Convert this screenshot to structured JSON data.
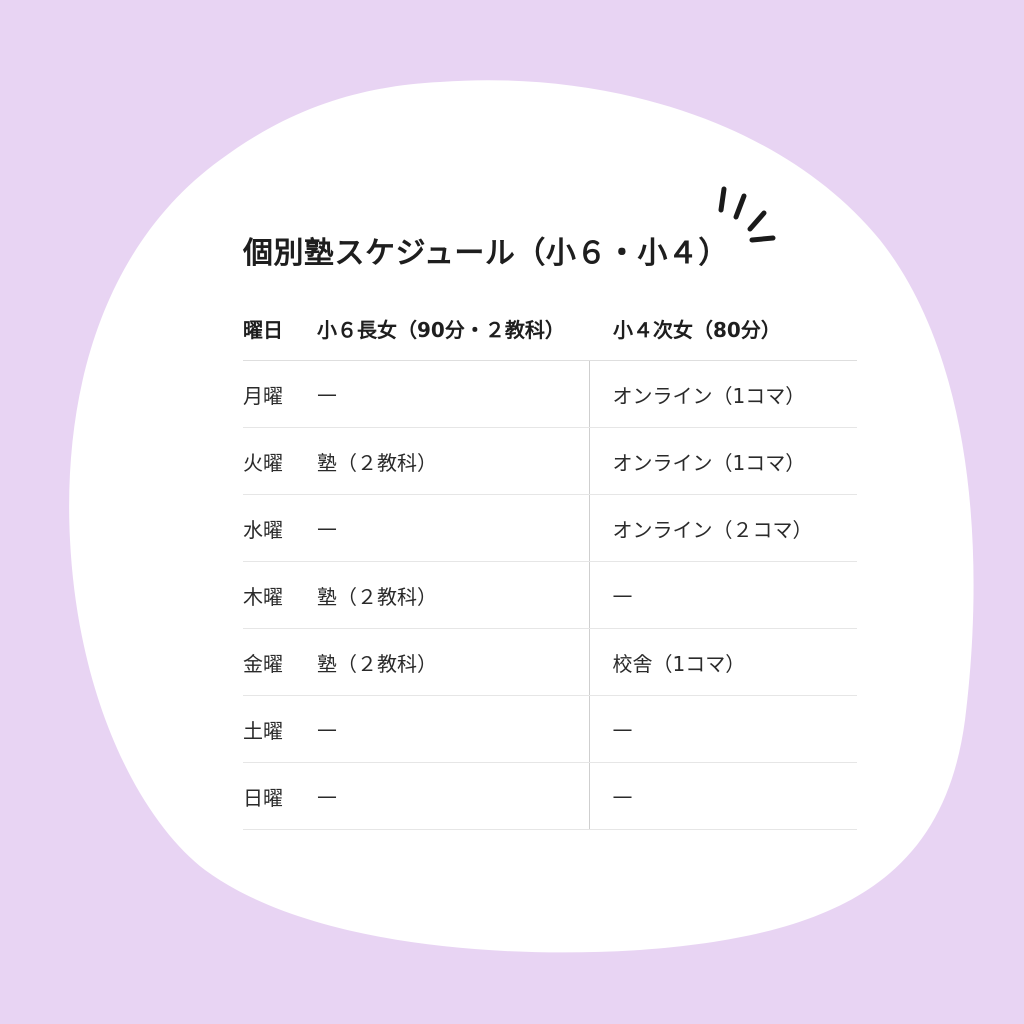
{
  "colors": {
    "background": "#e8d4f3",
    "card": "#ffffff",
    "text": "#222222",
    "divider": "#dedede"
  },
  "title": "個別塾スケジュール（小６・小４）",
  "table": {
    "headers": [
      "曜日",
      "小６長女（90分・２教科）",
      "小４次女（80分）"
    ],
    "rows": [
      {
        "day": "月曜",
        "elder": "—",
        "younger": "オンライン（1コマ）"
      },
      {
        "day": "火曜",
        "elder": "塾（２教科）",
        "younger": "オンライン（1コマ）"
      },
      {
        "day": "水曜",
        "elder": "—",
        "younger": "オンライン（２コマ）"
      },
      {
        "day": "木曜",
        "elder": "塾（２教科）",
        "younger": "—"
      },
      {
        "day": "金曜",
        "elder": "塾（２教科）",
        "younger": "校舎（1コマ）"
      },
      {
        "day": "土曜",
        "elder": "—",
        "younger": "—"
      },
      {
        "day": "日曜",
        "elder": "—",
        "younger": "—"
      }
    ]
  },
  "icons": {
    "decoration": "sparkle-lines-icon"
  }
}
